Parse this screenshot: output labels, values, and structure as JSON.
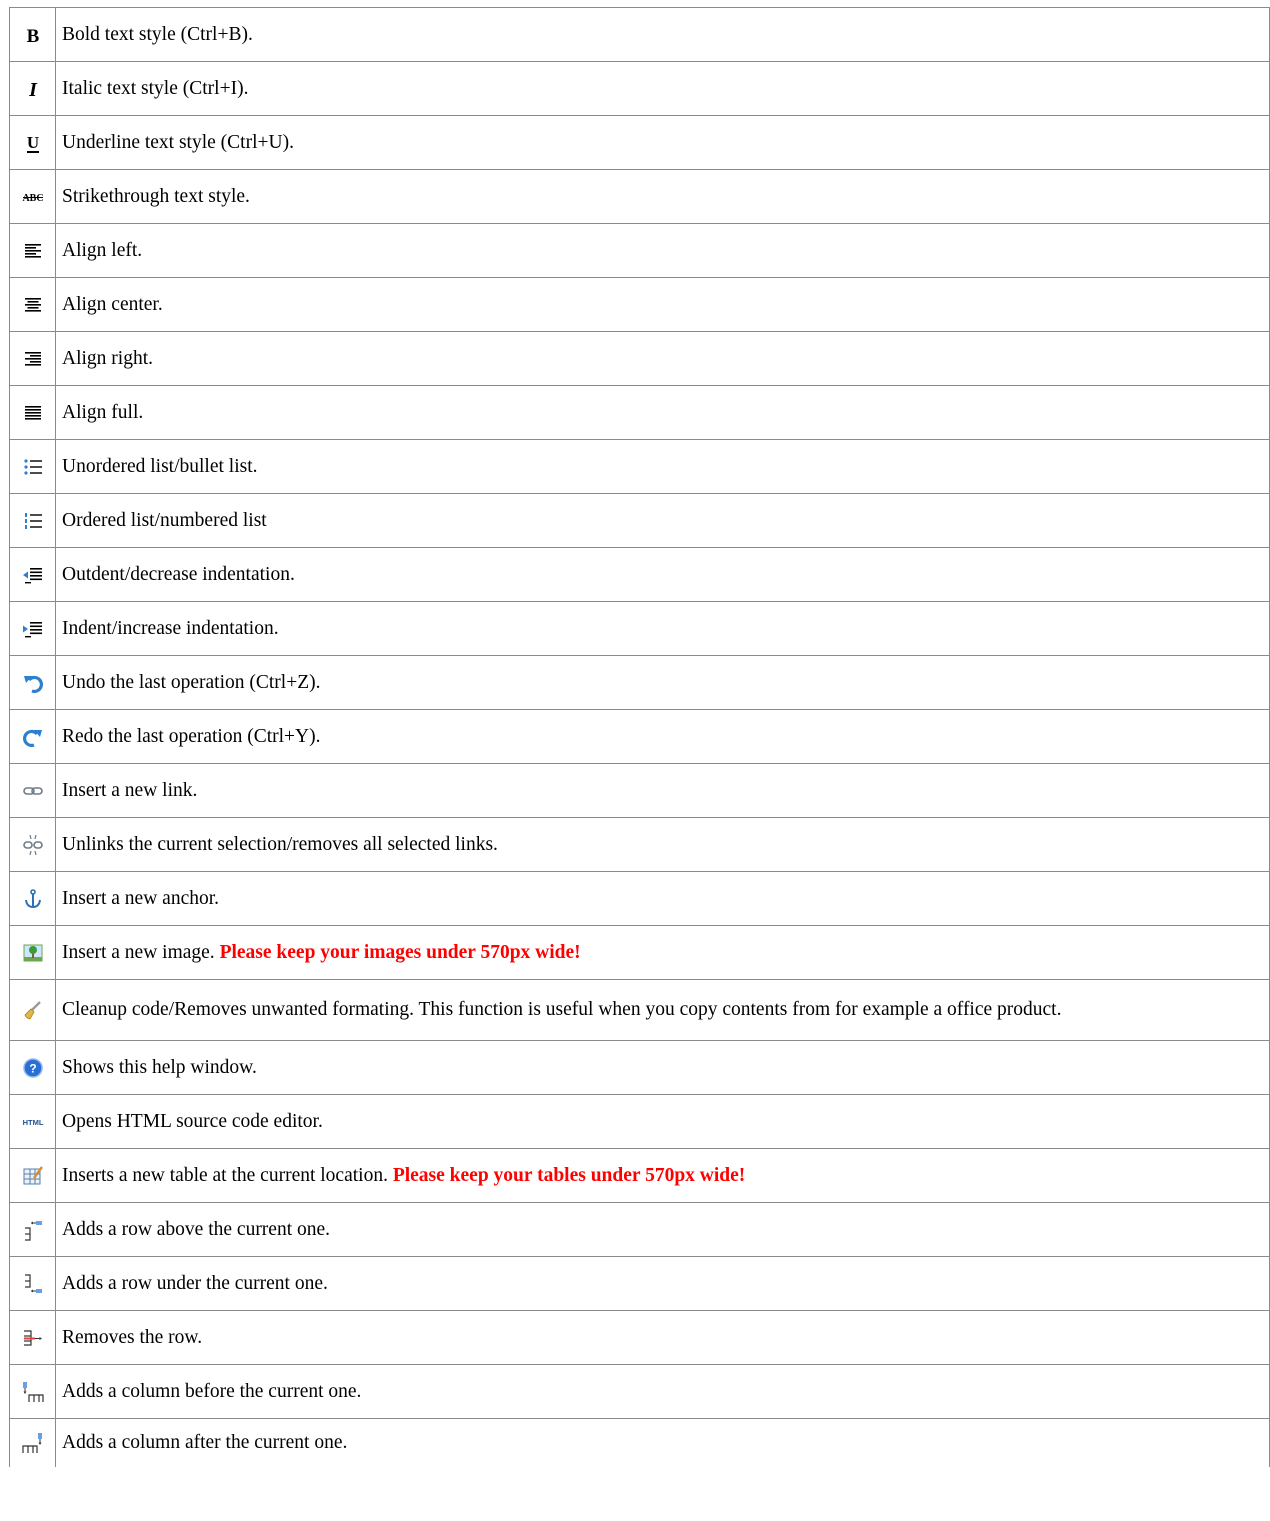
{
  "rows": [
    {
      "icon": "bold-icon",
      "text": "Bold text style (Ctrl+B)."
    },
    {
      "icon": "italic-icon",
      "text": "Italic text style (Ctrl+I)."
    },
    {
      "icon": "underline-icon",
      "text": "Underline text style (Ctrl+U)."
    },
    {
      "icon": "strikethrough-icon",
      "text": "Strikethrough text style."
    },
    {
      "icon": "align-left-icon",
      "text": "Align left."
    },
    {
      "icon": "align-center-icon",
      "text": "Align center."
    },
    {
      "icon": "align-right-icon",
      "text": "Align right."
    },
    {
      "icon": "align-full-icon",
      "text": "Align full."
    },
    {
      "icon": "bullet-list-icon",
      "text": "Unordered list/bullet list."
    },
    {
      "icon": "numbered-list-icon",
      "text": "Ordered list/numbered list"
    },
    {
      "icon": "outdent-icon",
      "text": "Outdent/decrease indentation."
    },
    {
      "icon": "indent-icon",
      "text": "Indent/increase indentation."
    },
    {
      "icon": "undo-icon",
      "text": "Undo the last operation (Ctrl+Z)."
    },
    {
      "icon": "redo-icon",
      "text": "Redo the last operation (Ctrl+Y)."
    },
    {
      "icon": "link-icon",
      "text": "Insert a new link."
    },
    {
      "icon": "unlink-icon",
      "text": "Unlinks the current selection/removes all selected links."
    },
    {
      "icon": "anchor-icon",
      "text": "Insert a new anchor."
    },
    {
      "icon": "image-icon",
      "text": "Insert a new image.",
      "warning": "Please keep your images under 570px wide!"
    },
    {
      "icon": "cleanup-brush-icon",
      "text": "Cleanup code/Removes unwanted formating. This function is useful when you copy contents from for example a office product."
    },
    {
      "icon": "help-icon",
      "text": "Shows this help window."
    },
    {
      "icon": "html-source-icon",
      "text": "Opens HTML source code editor."
    },
    {
      "icon": "insert-table-icon",
      "text": "Inserts a new table at the current location.",
      "warning": "Please keep your tables under 570px wide!"
    },
    {
      "icon": "row-above-icon",
      "text": "Adds a row above the current one."
    },
    {
      "icon": "row-below-icon",
      "text": "Adds a row under the current one."
    },
    {
      "icon": "remove-row-icon",
      "text": "Removes the row."
    },
    {
      "icon": "column-before-icon",
      "text": "Adds a column before the current one."
    },
    {
      "icon": "column-after-icon",
      "text": "Adds a column after the current one."
    }
  ],
  "icon_labels": {
    "strike": "ABC",
    "html": "HTML"
  },
  "colors": {
    "warning": "#ff0000",
    "border": "#8a8a8a",
    "help_blue": "#2a6fd6",
    "arrow_blue": "#2f7fcf"
  }
}
